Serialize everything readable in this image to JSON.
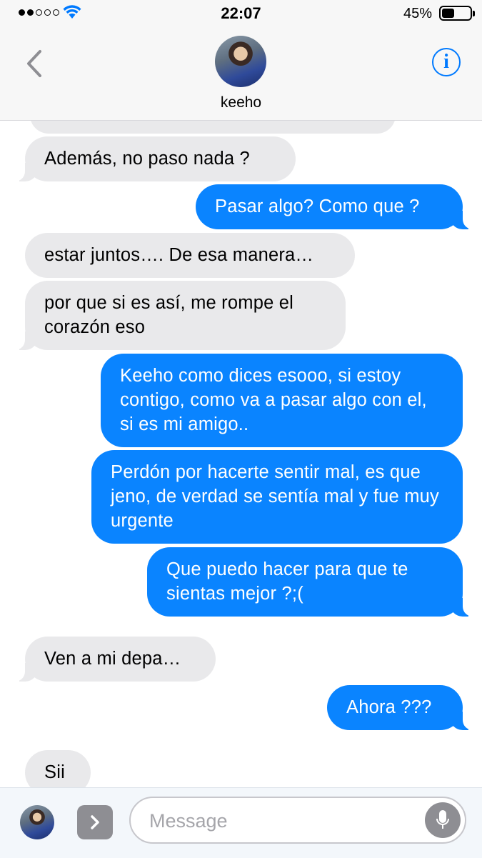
{
  "status_bar": {
    "time": "22:07",
    "battery_percent_label": "45%",
    "battery_level": 0.45,
    "signal_icon": "signal-dots-icon",
    "wifi_icon": "wifi-icon"
  },
  "header": {
    "contact_name": "keeho",
    "back_icon": "chevron-left-icon",
    "info_icon": "info-icon",
    "info_glyph": "i"
  },
  "messages": [
    {
      "from": "contact",
      "text": "Además, no paso nada ?"
    },
    {
      "from": "me",
      "text": "Pasar algo? Como que ?"
    },
    {
      "from": "contact",
      "text": "estar juntos…. De esa manera…"
    },
    {
      "from": "contact",
      "text": "por que si es así, me rompe el corazón eso"
    },
    {
      "from": "me",
      "text": "Keeho como dices esooo, si estoy contigo, como va a pasar algo con el, si es mi amigo.."
    },
    {
      "from": "me",
      "text": "Perdón por hacerte sentir mal, es que jeno, de verdad se sentía mal y fue muy urgente"
    },
    {
      "from": "me",
      "text": "Que puedo hacer para que te sientas mejor ?;("
    },
    {
      "from": "contact",
      "text": "Ven a mi depa…"
    },
    {
      "from": "me",
      "text": "Ahora ???"
    },
    {
      "from": "contact",
      "text": "Sii"
    }
  ],
  "input_bar": {
    "placeholder": "Message",
    "value": "",
    "apps_icon": "chevron-right-icon",
    "mic_icon": "microphone-icon"
  },
  "colors": {
    "outgoing_bubble": "#0a84ff",
    "incoming_bubble": "#e9e9eb",
    "accent": "#007aff"
  }
}
